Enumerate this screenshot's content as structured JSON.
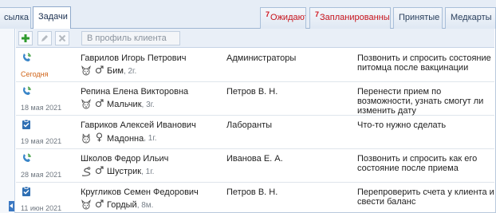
{
  "tabs": [
    {
      "label": "сылка"
    },
    {
      "label": "Задачи"
    },
    {
      "badge": "7",
      "label": "Ожидают"
    },
    {
      "badge": "7",
      "label": "Запланированные"
    },
    {
      "label": "Принятые"
    },
    {
      "label": "Медкарты"
    }
  ],
  "toolbar": {
    "add_icon": "plus-icon",
    "edit_icon": "pencil-icon",
    "delete_icon": "x-icon",
    "search_placeholder": "В профиль клиента"
  },
  "colors": {
    "add": "#2e9a2e",
    "today": "#d0651a",
    "badge": "#d0101a",
    "icon": "#3b78c2"
  },
  "rows": [
    {
      "type_icon": "phone-icon",
      "date": "Сегодня",
      "today": true,
      "client": "Гаврилов Игорь Петрович",
      "pet_icon": "dog-icon",
      "sex_icon": "male-icon",
      "pet": "Бим",
      "age": ", 2г.",
      "assignee": "Администраторы",
      "description": "Позвонить и спросить состояние питомца после вакцинации"
    },
    {
      "type_icon": "phone-icon",
      "date": "18 мая 2021",
      "today": false,
      "client": "Репина Елена Викторовна",
      "pet_icon": "dog-icon",
      "sex_icon": "male-icon",
      "pet": "Мальчик",
      "age": ", 3г.",
      "assignee": "Петров В. Н.",
      "description": "Перенести прием по возможности, узнать смогут ли изменить дату"
    },
    {
      "type_icon": "clipboard-check-icon",
      "date": "19 мая 2021",
      "today": false,
      "client": "Гавриков Алексей Иванович",
      "pet_icon": "cat-icon",
      "sex_icon": "female-icon",
      "pet": "Мадонна",
      "age": ", 1г.",
      "assignee": "Лаборанты",
      "description": "Что-то нужно сделать"
    },
    {
      "type_icon": "phone-icon",
      "date": "28 мая 2021",
      "today": false,
      "client": "Школов Федор Ильич",
      "pet_icon": "snake-icon",
      "sex_icon": "male-icon",
      "pet": "Шустрик",
      "age": ", 1г.",
      "assignee": "Иванова Е. А.",
      "description": "Позвонить и спросить как его состояние после приема"
    },
    {
      "type_icon": "clipboard-check-icon",
      "date": "11 июн 2021",
      "today": false,
      "client": "Кругликов Семен Федорович",
      "pet_icon": "dog-icon",
      "sex_icon": "male-icon",
      "pet": "Гордый",
      "age": ", 8м.",
      "assignee": "Петров В. Н.",
      "description": "Перепроверить счета у клиента и свести баланс"
    }
  ]
}
